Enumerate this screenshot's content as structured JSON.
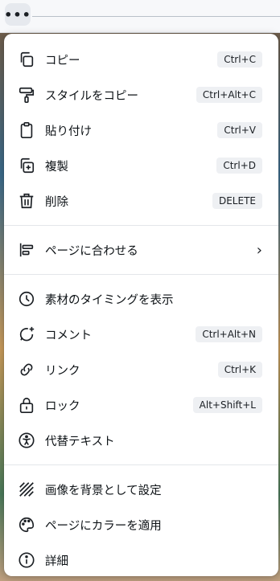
{
  "toolbar": {
    "more_label": "•••"
  },
  "menu": {
    "groups": [
      [
        {
          "label": "コピー",
          "shortcut": "Ctrl+C"
        },
        {
          "label": "スタイルをコピー",
          "shortcut": "Ctrl+Alt+C"
        },
        {
          "label": "貼り付け",
          "shortcut": "Ctrl+V"
        },
        {
          "label": "複製",
          "shortcut": "Ctrl+D"
        },
        {
          "label": "削除",
          "shortcut": "DELETE"
        }
      ],
      [
        {
          "label": "ページに合わせる",
          "submenu": "›"
        }
      ],
      [
        {
          "label": "素材のタイミングを表示"
        },
        {
          "label": "コメント",
          "shortcut": "Ctrl+Alt+N"
        },
        {
          "label": "リンク",
          "shortcut": "Ctrl+K"
        },
        {
          "label": "ロック",
          "shortcut": "Alt+Shift+L"
        },
        {
          "label": "代替テキスト"
        }
      ],
      [
        {
          "label": "画像を背景として設定"
        },
        {
          "label": "ページにカラーを適用"
        },
        {
          "label": "詳細"
        }
      ]
    ]
  }
}
